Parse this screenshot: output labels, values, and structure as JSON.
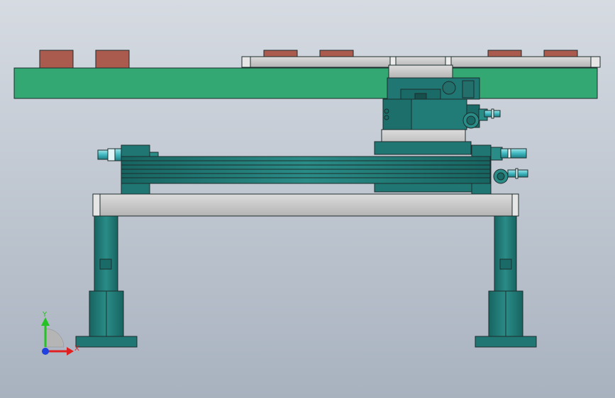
{
  "viewport": {
    "background_top": "#d6dbe2",
    "background_bottom": "#a8b2bf"
  },
  "colors": {
    "plate_green": "#33a872",
    "block_red": "#ab5a4e",
    "rail_gray": "#c6c6c6",
    "teal_dark": "#1a6b68",
    "teal_mid": "#217c78",
    "teal_light": "#2a8c87",
    "cyan_fitting": "#4fc7cf",
    "outline": "#1d2c2c",
    "axis_x": "#e02020",
    "axis_y": "#24c224",
    "axis_z": "#2040e0"
  },
  "triad": {
    "x_label": "X",
    "y_label": "Y",
    "x_icon": "axis-x-arrow-icon",
    "y_icon": "axis-y-arrow-icon",
    "z_icon": "axis-z-origin-icon"
  }
}
